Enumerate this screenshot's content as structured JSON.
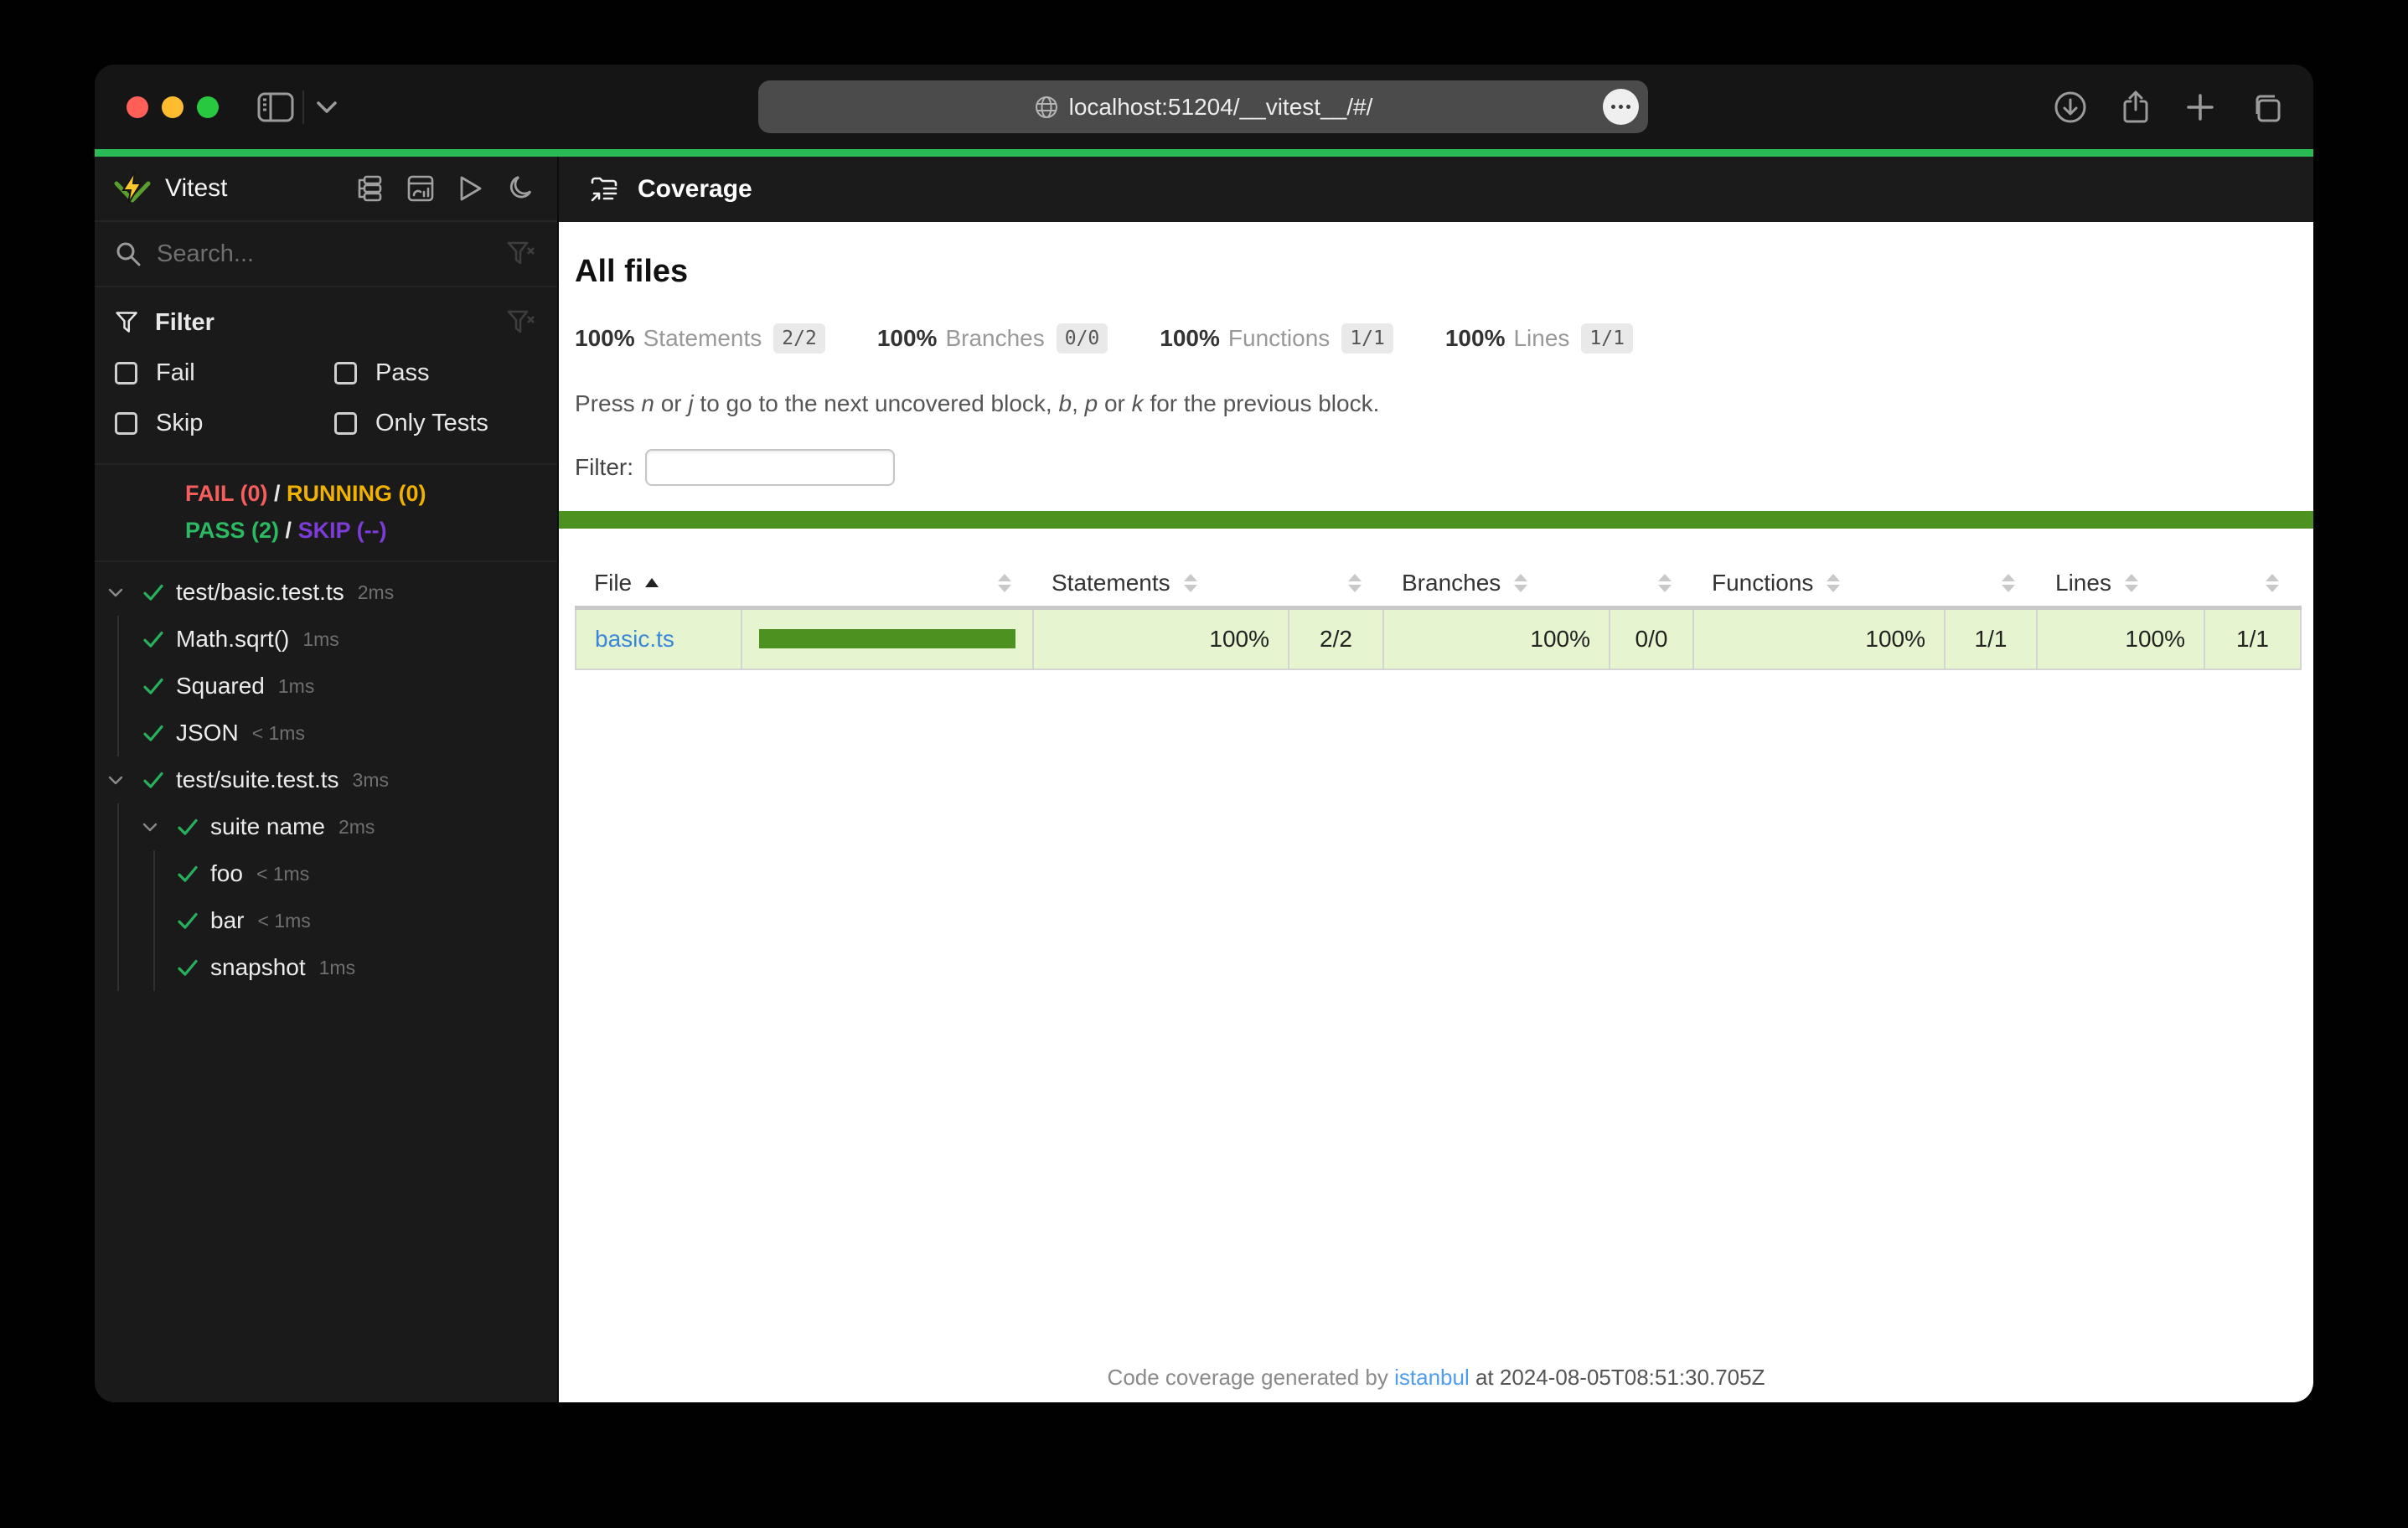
{
  "browser": {
    "url": "localhost:51204/__vitest__/#/",
    "toolbar_icons": [
      "sidebar-toggle-icon",
      "chevron-down-icon",
      "globe-icon",
      "more-options-icon",
      "download-icon",
      "share-icon",
      "new-tab-icon",
      "tab-overview-icon"
    ]
  },
  "sidebar": {
    "app_name": "Vitest",
    "header_icons": [
      "tree-view-icon",
      "dashboard-icon",
      "run-all-icon",
      "dark-mode-icon"
    ],
    "search": {
      "placeholder": "Search...",
      "value": ""
    },
    "filter": {
      "title": "Filter",
      "options": [
        {
          "label": "Fail",
          "checked": false
        },
        {
          "label": "Pass",
          "checked": false
        },
        {
          "label": "Skip",
          "checked": false
        },
        {
          "label": "Only Tests",
          "checked": false
        }
      ]
    },
    "status": {
      "fail": "FAIL (0)",
      "running": "RUNNING (0)",
      "pass": "PASS (2)",
      "skip": "SKIP (--)",
      "separator": "/"
    },
    "tree": [
      {
        "label": "test/basic.test.ts",
        "duration": "2ms",
        "level": 0,
        "expandable": true,
        "state": "pass"
      },
      {
        "label": "Math.sqrt()",
        "duration": "1ms",
        "level": 1,
        "expandable": false,
        "state": "pass"
      },
      {
        "label": "Squared",
        "duration": "1ms",
        "level": 1,
        "expandable": false,
        "state": "pass"
      },
      {
        "label": "JSON",
        "duration": "< 1ms",
        "level": 1,
        "expandable": false,
        "state": "pass"
      },
      {
        "label": "test/suite.test.ts",
        "duration": "3ms",
        "level": 0,
        "expandable": true,
        "state": "pass"
      },
      {
        "label": "suite name",
        "duration": "2ms",
        "level": 1,
        "expandable": true,
        "state": "pass"
      },
      {
        "label": "foo",
        "duration": "< 1ms",
        "level": 2,
        "expandable": false,
        "state": "pass"
      },
      {
        "label": "bar",
        "duration": "< 1ms",
        "level": 2,
        "expandable": false,
        "state": "pass"
      },
      {
        "label": "snapshot",
        "duration": "1ms",
        "level": 2,
        "expandable": false,
        "state": "pass"
      }
    ]
  },
  "coverage": {
    "header_title": "Coverage",
    "page_title": "All files",
    "summary": [
      {
        "pct": "100%",
        "label": "Statements",
        "fraction": "2/2"
      },
      {
        "pct": "100%",
        "label": "Branches",
        "fraction": "0/0"
      },
      {
        "pct": "100%",
        "label": "Functions",
        "fraction": "1/1"
      },
      {
        "pct": "100%",
        "label": "Lines",
        "fraction": "1/1"
      }
    ],
    "hint_segments": [
      {
        "text": "Press "
      },
      {
        "text": "n",
        "italic": true
      },
      {
        "text": " or "
      },
      {
        "text": "j",
        "italic": true
      },
      {
        "text": " to go to the next uncovered block, "
      },
      {
        "text": "b",
        "italic": true
      },
      {
        "text": ", "
      },
      {
        "text": "p",
        "italic": true
      },
      {
        "text": " or "
      },
      {
        "text": "k",
        "italic": true
      },
      {
        "text": " for the previous block."
      }
    ],
    "filter_label": "Filter:",
    "filter_value": "",
    "table": {
      "columns": [
        "File",
        "Statements",
        "Branches",
        "Functions",
        "Lines"
      ],
      "sort": {
        "column": "File",
        "direction": "asc"
      },
      "rows": [
        {
          "file": "basic.ts",
          "bar_percent": 100,
          "statements_pct": "100%",
          "statements": "2/2",
          "branches_pct": "100%",
          "branches": "0/0",
          "functions_pct": "100%",
          "functions": "1/1",
          "lines_pct": "100%",
          "lines": "1/1",
          "coverage_class": "high"
        }
      ]
    },
    "footer": {
      "prefix": "Code coverage generated by ",
      "link_text": "istanbul",
      "suffix": " at 2024-08-05T08:51:30.705Z"
    }
  },
  "colors": {
    "accent_green": "#2abb56",
    "fail_red": "#f65e5e",
    "running_yellow": "#f0b100",
    "pass_green": "#2bb961",
    "skip_purple": "#7d3bd8",
    "check_green": "#27b15c",
    "coverage_high_bar": "#4d9221",
    "coverage_high_bg": "#e6f5d0",
    "link_blue": "#3a87d9",
    "footer_link_blue": "#4f9cf0"
  }
}
